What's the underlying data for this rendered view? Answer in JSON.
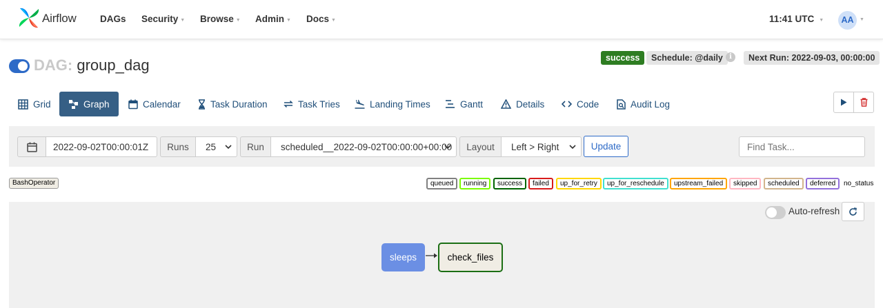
{
  "navbar": {
    "brand": "Airflow",
    "items": [
      {
        "label": "DAGs",
        "caret": false
      },
      {
        "label": "Security",
        "caret": true
      },
      {
        "label": "Browse",
        "caret": true
      },
      {
        "label": "Admin",
        "caret": true
      },
      {
        "label": "Docs",
        "caret": true
      }
    ],
    "clock": "11:41 UTC",
    "avatar": "AA"
  },
  "dag": {
    "prefix": "DAG:",
    "name": "group_dag",
    "enabled": true,
    "state_badge": "success",
    "schedule": "Schedule: @daily",
    "next_run": "Next Run: 2022-09-03, 00:00:00"
  },
  "tabs": [
    {
      "label": "Grid",
      "icon": "grid-icon"
    },
    {
      "label": "Graph",
      "icon": "graph-icon",
      "active": true
    },
    {
      "label": "Calendar",
      "icon": "calendar-icon"
    },
    {
      "label": "Task Duration",
      "icon": "hourglass-icon"
    },
    {
      "label": "Task Tries",
      "icon": "retry-icon"
    },
    {
      "label": "Landing Times",
      "icon": "plane-landing-icon"
    },
    {
      "label": "Gantt",
      "icon": "gantt-icon"
    },
    {
      "label": "Details",
      "icon": "warning-icon"
    },
    {
      "label": "Code",
      "icon": "code-icon"
    },
    {
      "label": "Audit Log",
      "icon": "search-file-icon"
    }
  ],
  "filters": {
    "base_date": "2022-09-02T00:00:01Z",
    "runs_label": "Runs",
    "runs_value": "25",
    "run_label": "Run",
    "run_value": "scheduled__2022-09-02T00:00:00+00:00",
    "layout_label": "Layout",
    "layout_value": "Left > Right",
    "update_label": "Update",
    "find_task_placeholder": "Find Task..."
  },
  "legend": {
    "operator": "BashOperator",
    "states": [
      {
        "label": "queued",
        "color": "#808080"
      },
      {
        "label": "running",
        "color": "#7cfc00"
      },
      {
        "label": "success",
        "color": "#006400"
      },
      {
        "label": "failed",
        "color": "#d81b1b"
      },
      {
        "label": "up_for_retry",
        "color": "#ffd700"
      },
      {
        "label": "up_for_reschedule",
        "color": "#40e0d0"
      },
      {
        "label": "upstream_failed",
        "color": "#ffa500"
      },
      {
        "label": "skipped",
        "color": "#ffb6c1"
      },
      {
        "label": "scheduled",
        "color": "#d2b48c"
      },
      {
        "label": "deferred",
        "color": "#9370db"
      }
    ],
    "no_status": "no_status"
  },
  "graph": {
    "auto_refresh_label": "Auto-refresh",
    "auto_refresh_on": false,
    "nodes": [
      {
        "label": "sleeps",
        "kind": "task-group",
        "color": "#6b8fe4"
      },
      {
        "label": "check_files",
        "kind": "task",
        "state": "success"
      }
    ]
  }
}
